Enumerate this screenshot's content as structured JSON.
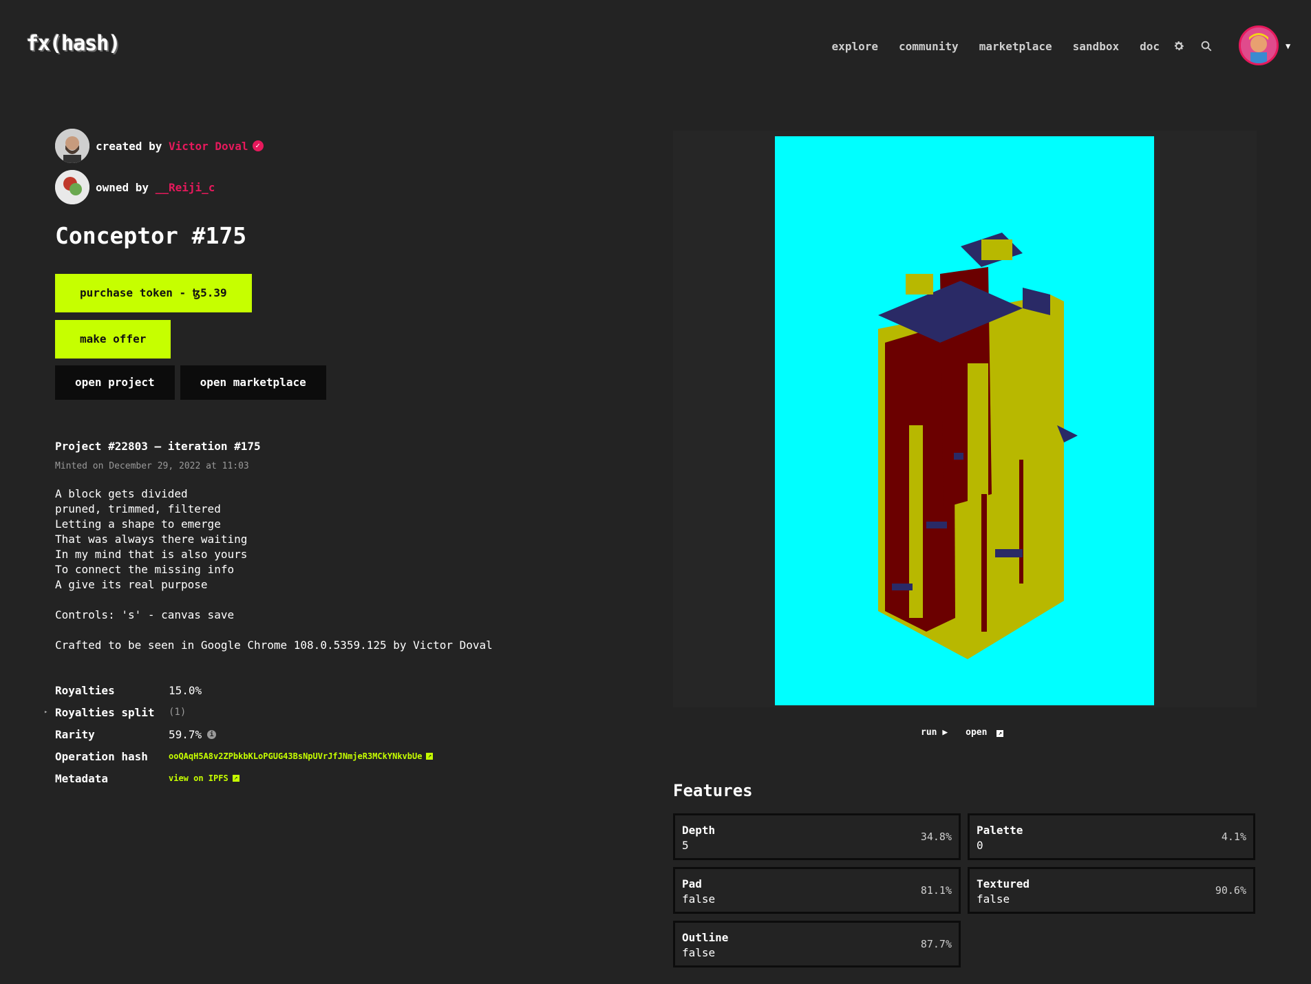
{
  "header": {
    "logo": "fx(hash)",
    "nav": [
      "explore",
      "community",
      "marketplace",
      "sandbox",
      "doc"
    ],
    "icons": [
      "gear-icon",
      "search-icon",
      "chevron-down-icon"
    ]
  },
  "creator": {
    "prefix": "created by",
    "name": "Victor Doval",
    "verified_glyph": "✓"
  },
  "owner": {
    "prefix": "owned by",
    "name": "__Reiji_c"
  },
  "token": {
    "title": "Conceptor #175",
    "purchase_label": "purchase token - ꜩ5.39",
    "offer_label": "make offer",
    "open_project_label": "open project",
    "open_marketplace_label": "open marketplace"
  },
  "project": {
    "heading": "Project #22803 – iteration #175",
    "minted": "Minted on December 29, 2022 at 11:03",
    "description": "A block gets divided\npruned, trimmed, filtered\nLetting a shape to emerge\nThat was always there waiting\nIn my mind that is also yours\nTo connect the missing info\nA give its real purpose\n\nControls: 's' - canvas save\n\nCrafted to be seen in Google Chrome 108.0.5359.125 by Victor Doval"
  },
  "properties": {
    "royalties_label": "Royalties",
    "royalties_value": "15.0%",
    "split_label": "Royalties split",
    "split_value": "(1)",
    "rarity_label": "Rarity",
    "rarity_value": "59.7%",
    "op_hash_label": "Operation hash",
    "op_hash_value": "ooQAqH5A8v2ZPbkbKLoPGUG43BsNpUVrJfJNmjeR3MCkYNkvbUe",
    "metadata_label": "Metadata",
    "metadata_value": "view on IPFS"
  },
  "preview": {
    "run_label": "run",
    "open_label": "open",
    "bg_color": "#00ffff"
  },
  "features": {
    "title": "Features",
    "items": [
      {
        "name": "Depth",
        "value": "5",
        "pct": "34.8%"
      },
      {
        "name": "Palette",
        "value": "0",
        "pct": "4.1%"
      },
      {
        "name": "Pad",
        "value": "false",
        "pct": "81.1%"
      },
      {
        "name": "Textured",
        "value": "false",
        "pct": "90.6%"
      },
      {
        "name": "Outline",
        "value": "false",
        "pct": "87.7%"
      }
    ]
  },
  "colors": {
    "accent_pink": "#e6195c",
    "accent_lime": "#c6ff00",
    "background": "#232323"
  }
}
